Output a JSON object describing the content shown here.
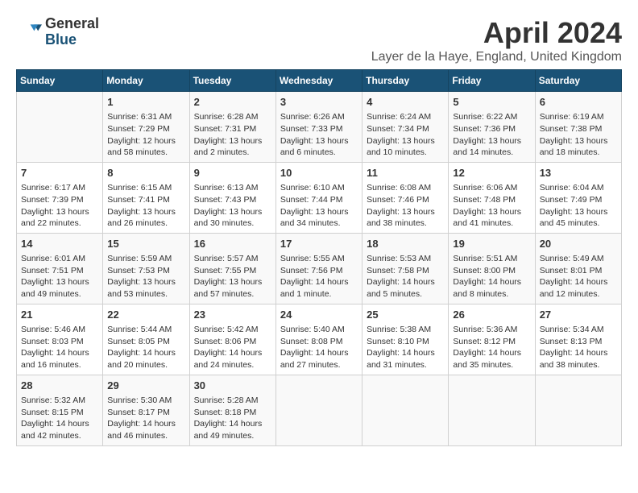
{
  "logo": {
    "general": "General",
    "blue": "Blue"
  },
  "title": "April 2024",
  "location": "Layer de la Haye, England, United Kingdom",
  "days_header": [
    "Sunday",
    "Monday",
    "Tuesday",
    "Wednesday",
    "Thursday",
    "Friday",
    "Saturday"
  ],
  "weeks": [
    [
      {
        "day": "",
        "info": ""
      },
      {
        "day": "1",
        "info": "Sunrise: 6:31 AM\nSunset: 7:29 PM\nDaylight: 12 hours\nand 58 minutes."
      },
      {
        "day": "2",
        "info": "Sunrise: 6:28 AM\nSunset: 7:31 PM\nDaylight: 13 hours\nand 2 minutes."
      },
      {
        "day": "3",
        "info": "Sunrise: 6:26 AM\nSunset: 7:33 PM\nDaylight: 13 hours\nand 6 minutes."
      },
      {
        "day": "4",
        "info": "Sunrise: 6:24 AM\nSunset: 7:34 PM\nDaylight: 13 hours\nand 10 minutes."
      },
      {
        "day": "5",
        "info": "Sunrise: 6:22 AM\nSunset: 7:36 PM\nDaylight: 13 hours\nand 14 minutes."
      },
      {
        "day": "6",
        "info": "Sunrise: 6:19 AM\nSunset: 7:38 PM\nDaylight: 13 hours\nand 18 minutes."
      }
    ],
    [
      {
        "day": "7",
        "info": "Sunrise: 6:17 AM\nSunset: 7:39 PM\nDaylight: 13 hours\nand 22 minutes."
      },
      {
        "day": "8",
        "info": "Sunrise: 6:15 AM\nSunset: 7:41 PM\nDaylight: 13 hours\nand 26 minutes."
      },
      {
        "day": "9",
        "info": "Sunrise: 6:13 AM\nSunset: 7:43 PM\nDaylight: 13 hours\nand 30 minutes."
      },
      {
        "day": "10",
        "info": "Sunrise: 6:10 AM\nSunset: 7:44 PM\nDaylight: 13 hours\nand 34 minutes."
      },
      {
        "day": "11",
        "info": "Sunrise: 6:08 AM\nSunset: 7:46 PM\nDaylight: 13 hours\nand 38 minutes."
      },
      {
        "day": "12",
        "info": "Sunrise: 6:06 AM\nSunset: 7:48 PM\nDaylight: 13 hours\nand 41 minutes."
      },
      {
        "day": "13",
        "info": "Sunrise: 6:04 AM\nSunset: 7:49 PM\nDaylight: 13 hours\nand 45 minutes."
      }
    ],
    [
      {
        "day": "14",
        "info": "Sunrise: 6:01 AM\nSunset: 7:51 PM\nDaylight: 13 hours\nand 49 minutes."
      },
      {
        "day": "15",
        "info": "Sunrise: 5:59 AM\nSunset: 7:53 PM\nDaylight: 13 hours\nand 53 minutes."
      },
      {
        "day": "16",
        "info": "Sunrise: 5:57 AM\nSunset: 7:55 PM\nDaylight: 13 hours\nand 57 minutes."
      },
      {
        "day": "17",
        "info": "Sunrise: 5:55 AM\nSunset: 7:56 PM\nDaylight: 14 hours\nand 1 minute."
      },
      {
        "day": "18",
        "info": "Sunrise: 5:53 AM\nSunset: 7:58 PM\nDaylight: 14 hours\nand 5 minutes."
      },
      {
        "day": "19",
        "info": "Sunrise: 5:51 AM\nSunset: 8:00 PM\nDaylight: 14 hours\nand 8 minutes."
      },
      {
        "day": "20",
        "info": "Sunrise: 5:49 AM\nSunset: 8:01 PM\nDaylight: 14 hours\nand 12 minutes."
      }
    ],
    [
      {
        "day": "21",
        "info": "Sunrise: 5:46 AM\nSunset: 8:03 PM\nDaylight: 14 hours\nand 16 minutes."
      },
      {
        "day": "22",
        "info": "Sunrise: 5:44 AM\nSunset: 8:05 PM\nDaylight: 14 hours\nand 20 minutes."
      },
      {
        "day": "23",
        "info": "Sunrise: 5:42 AM\nSunset: 8:06 PM\nDaylight: 14 hours\nand 24 minutes."
      },
      {
        "day": "24",
        "info": "Sunrise: 5:40 AM\nSunset: 8:08 PM\nDaylight: 14 hours\nand 27 minutes."
      },
      {
        "day": "25",
        "info": "Sunrise: 5:38 AM\nSunset: 8:10 PM\nDaylight: 14 hours\nand 31 minutes."
      },
      {
        "day": "26",
        "info": "Sunrise: 5:36 AM\nSunset: 8:12 PM\nDaylight: 14 hours\nand 35 minutes."
      },
      {
        "day": "27",
        "info": "Sunrise: 5:34 AM\nSunset: 8:13 PM\nDaylight: 14 hours\nand 38 minutes."
      }
    ],
    [
      {
        "day": "28",
        "info": "Sunrise: 5:32 AM\nSunset: 8:15 PM\nDaylight: 14 hours\nand 42 minutes."
      },
      {
        "day": "29",
        "info": "Sunrise: 5:30 AM\nSunset: 8:17 PM\nDaylight: 14 hours\nand 46 minutes."
      },
      {
        "day": "30",
        "info": "Sunrise: 5:28 AM\nSunset: 8:18 PM\nDaylight: 14 hours\nand 49 minutes."
      },
      {
        "day": "",
        "info": ""
      },
      {
        "day": "",
        "info": ""
      },
      {
        "day": "",
        "info": ""
      },
      {
        "day": "",
        "info": ""
      }
    ]
  ]
}
